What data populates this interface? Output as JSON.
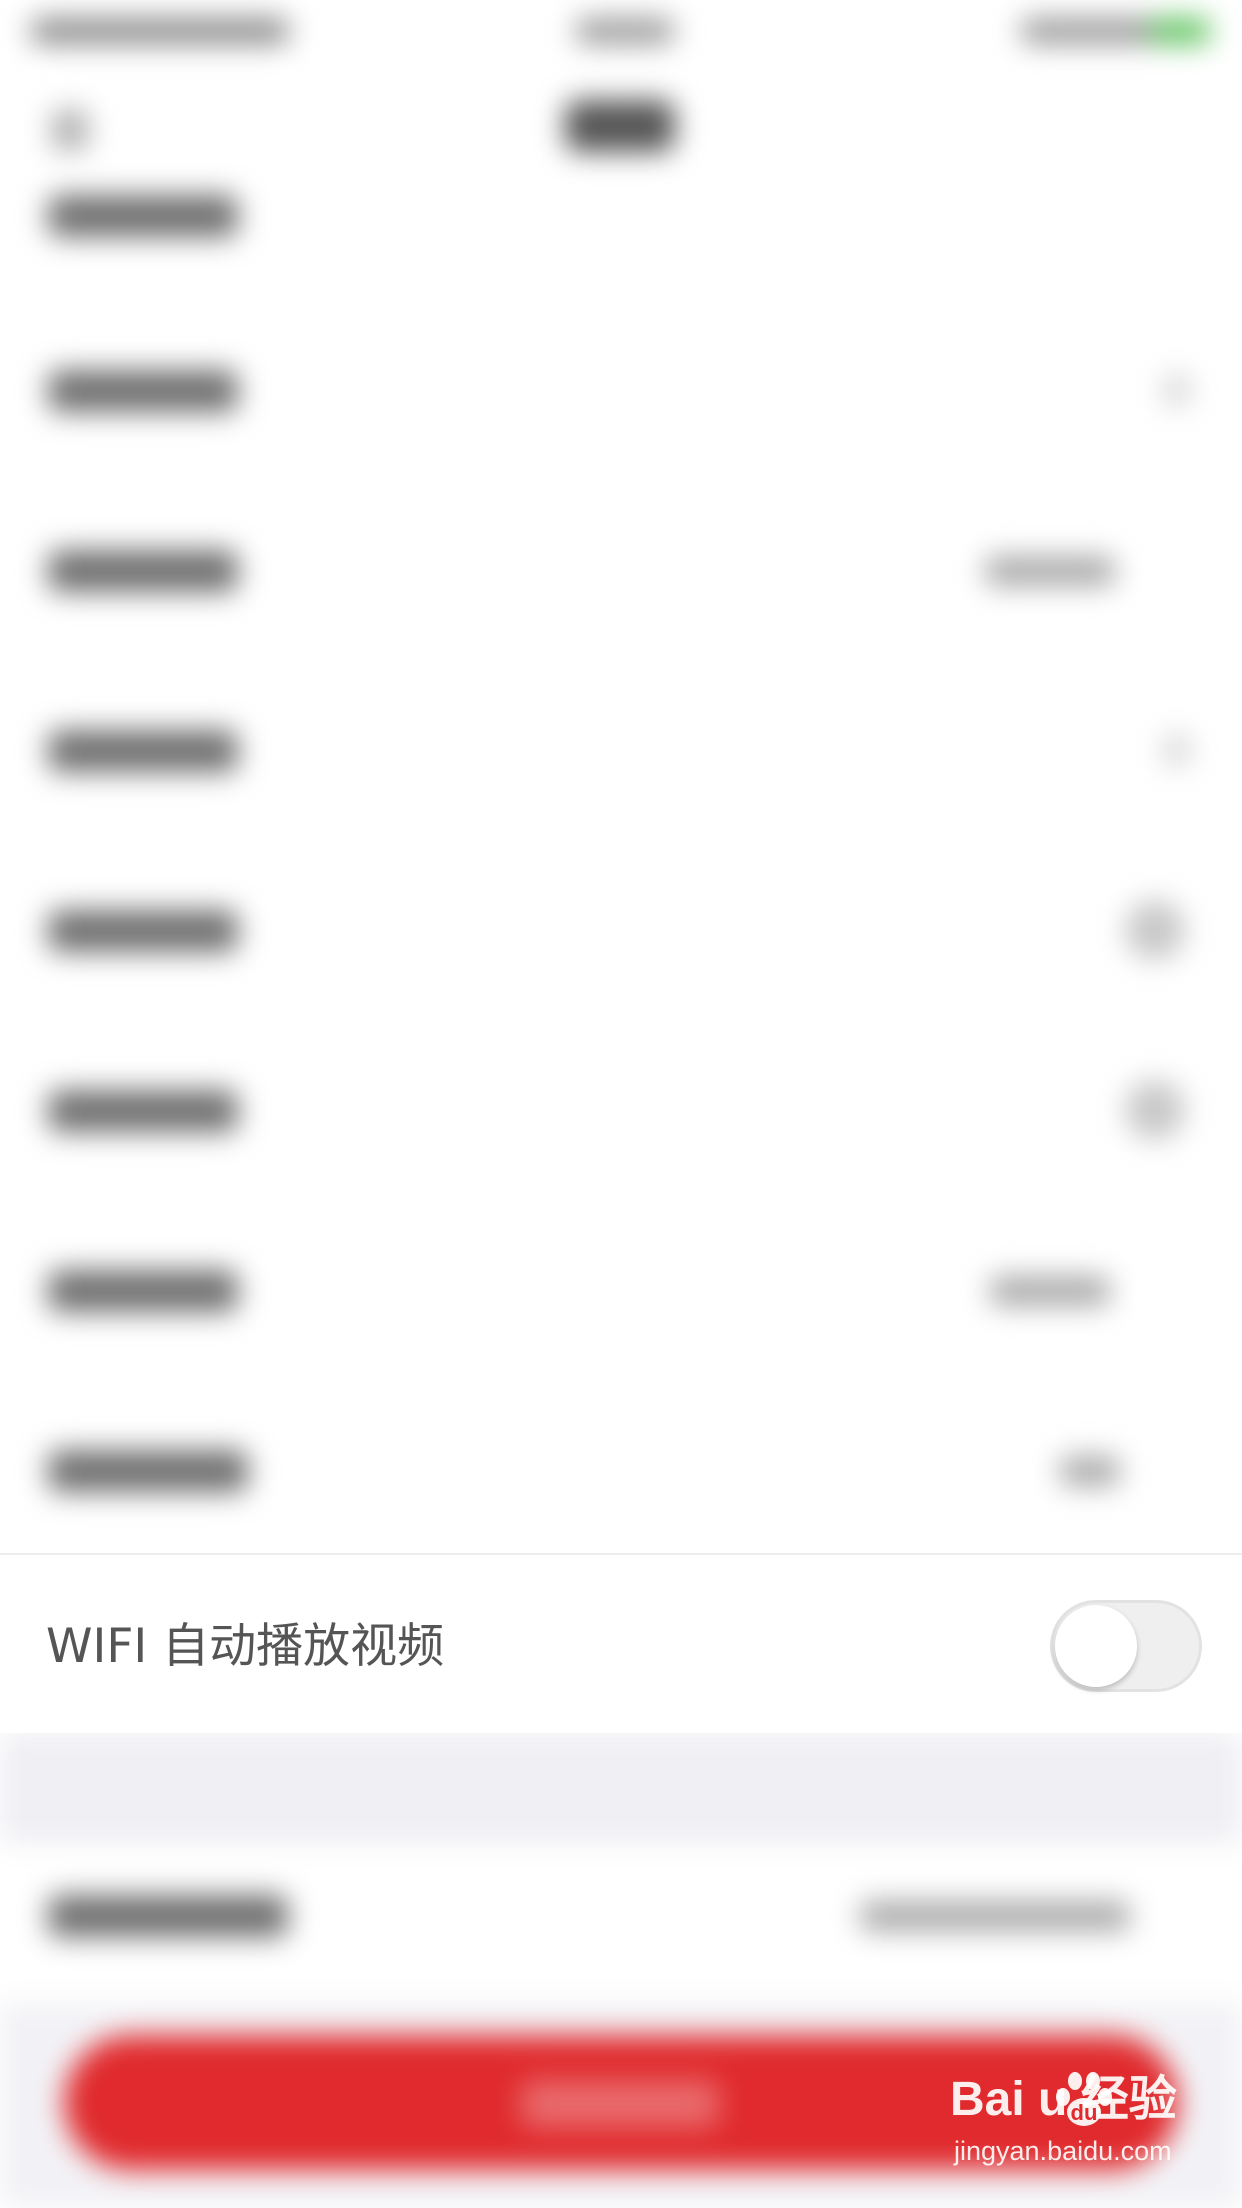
{
  "settings": {
    "wifi_autoplay": {
      "label": "WIFI 自动播放视频",
      "enabled": false
    }
  },
  "watermark": {
    "logo": "Bai  u 经验",
    "site": "jingyan.baidu.com",
    "colors": {
      "text": "#ffffff"
    }
  },
  "colors": {
    "accent_button": "#e02a2d",
    "toggle_off_track": "#efefef",
    "label_text": "#555555",
    "section_gap": "#efeff4"
  }
}
